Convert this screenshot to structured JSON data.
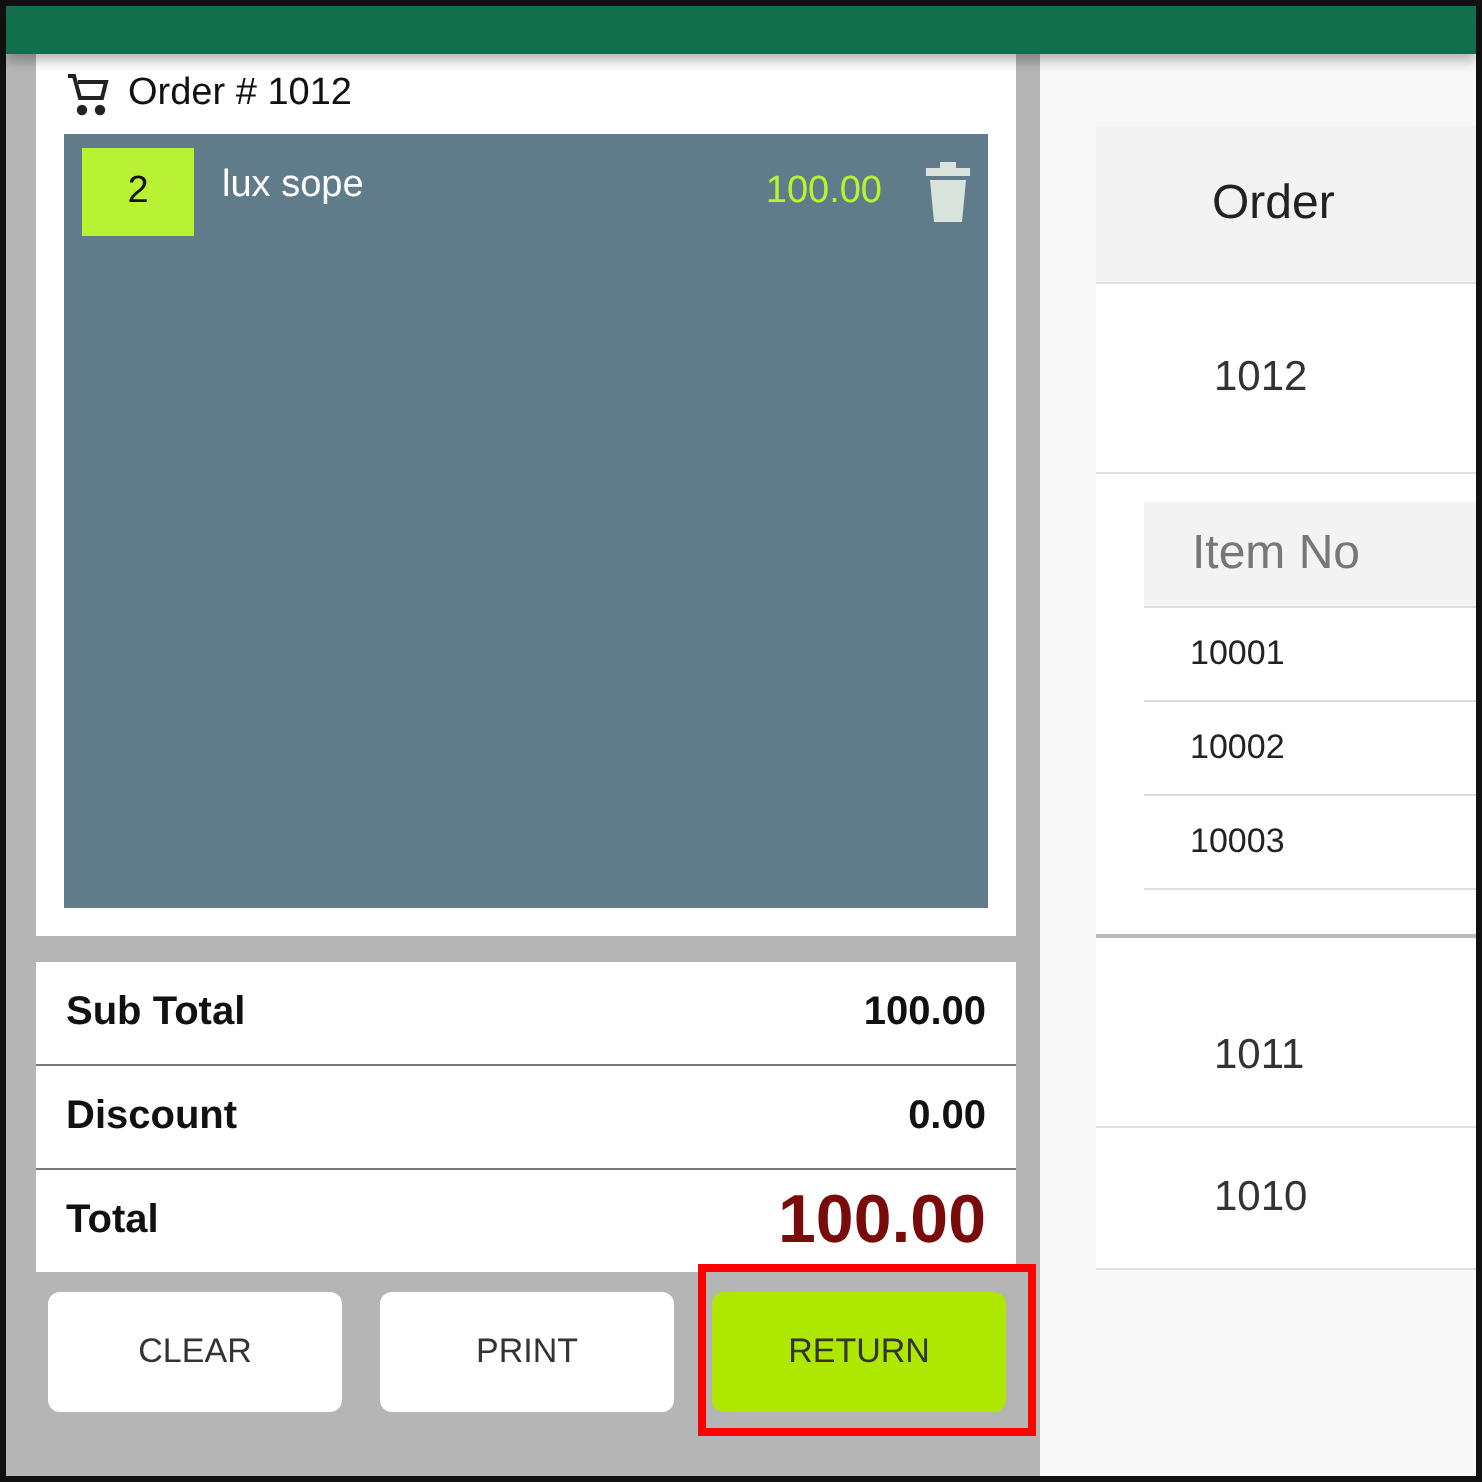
{
  "order_panel": {
    "title": "Order # 1012",
    "items": [
      {
        "quantity": "2",
        "name": "lux sope",
        "price": "100.00"
      }
    ],
    "summary": [
      {
        "label": "Sub Total",
        "value": "100.00",
        "kind": "normal"
      },
      {
        "label": "Discount",
        "value": "0.00",
        "kind": "normal"
      },
      {
        "label": "Total",
        "value": "100.00",
        "kind": "grand"
      }
    ],
    "buttons": [
      {
        "label": "CLEAR",
        "highlighted": false
      },
      {
        "label": "PRINT",
        "highlighted": false
      },
      {
        "label": "RETURN",
        "highlighted": true
      }
    ]
  },
  "orders_table": {
    "columns": [
      "Order"
    ],
    "rows": [
      {
        "order": "1012",
        "expanded": true,
        "detail": {
          "columns": [
            "Item No"
          ],
          "rows": [
            "10001",
            "10002",
            "10003"
          ]
        }
      },
      {
        "order": "1011",
        "expanded": false
      },
      {
        "order": "1010",
        "expanded": false
      }
    ]
  }
}
